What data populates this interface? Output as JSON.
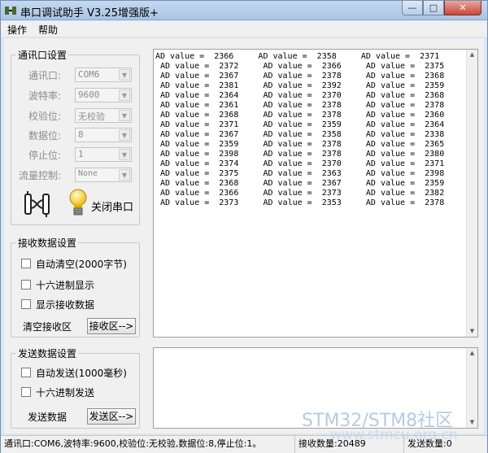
{
  "window": {
    "title": "串口调试助手 V3.25增强版+",
    "controls": {
      "minimize": "—",
      "maximize": "□",
      "close": "✕"
    }
  },
  "menu": [
    "操作",
    "帮助"
  ],
  "serial_settings": {
    "title": "通讯口设置",
    "fields": [
      {
        "label": "通讯口:",
        "value": "COM6"
      },
      {
        "label": "波特率:",
        "value": "9600"
      },
      {
        "label": "校验位:",
        "value": "无校验"
      },
      {
        "label": "数据位:",
        "value": "8"
      },
      {
        "label": "停止位:",
        "value": "1"
      },
      {
        "label": "流量控制:",
        "value": "None"
      }
    ],
    "close_port_label": "关闭串口"
  },
  "receive_settings": {
    "title": "接收数据设置",
    "options": [
      "自动清空(2000字节)",
      "十六进制显示",
      "显示接收数据"
    ],
    "clear_label": "清空接收区",
    "area_button": "接收区-->"
  },
  "send_settings": {
    "title": "发送数据设置",
    "options": [
      "自动发送(1000毫秒)",
      "十六进制发送"
    ],
    "send_label": "发送数据",
    "area_button": "发送区-->"
  },
  "receive_area": {
    "rows": [
      [
        "2366",
        "2358",
        "2371"
      ],
      [
        "2372",
        "2366",
        "2375"
      ],
      [
        "2367",
        "2378",
        "2368"
      ],
      [
        "2381",
        "2392",
        "2359"
      ],
      [
        "2364",
        "2370",
        "2368"
      ],
      [
        "2361",
        "2378",
        "2378"
      ],
      [
        "2368",
        "2378",
        "2360"
      ],
      [
        "2371",
        "2359",
        "2364"
      ],
      [
        "2367",
        "2358",
        "2338"
      ],
      [
        "2359",
        "2378",
        "2365"
      ],
      [
        "2398",
        "2378",
        "2380"
      ],
      [
        "2374",
        "2370",
        "2371"
      ],
      [
        "2375",
        "2363",
        "2398"
      ],
      [
        "2368",
        "2367",
        "2359"
      ],
      [
        "2366",
        "2373",
        "2382"
      ],
      [
        "2373",
        "2353",
        "2378"
      ]
    ]
  },
  "status": {
    "config": "通讯口:COM6,波特率:9600,校验位:无校验,数据位:8,停止位:1。",
    "rx_count": "接收数量:20489",
    "tx_count": "发送数量:0"
  },
  "watermark": {
    "main": "STM32/STM8社区",
    "sub": "www.stmcu.org.cn"
  }
}
